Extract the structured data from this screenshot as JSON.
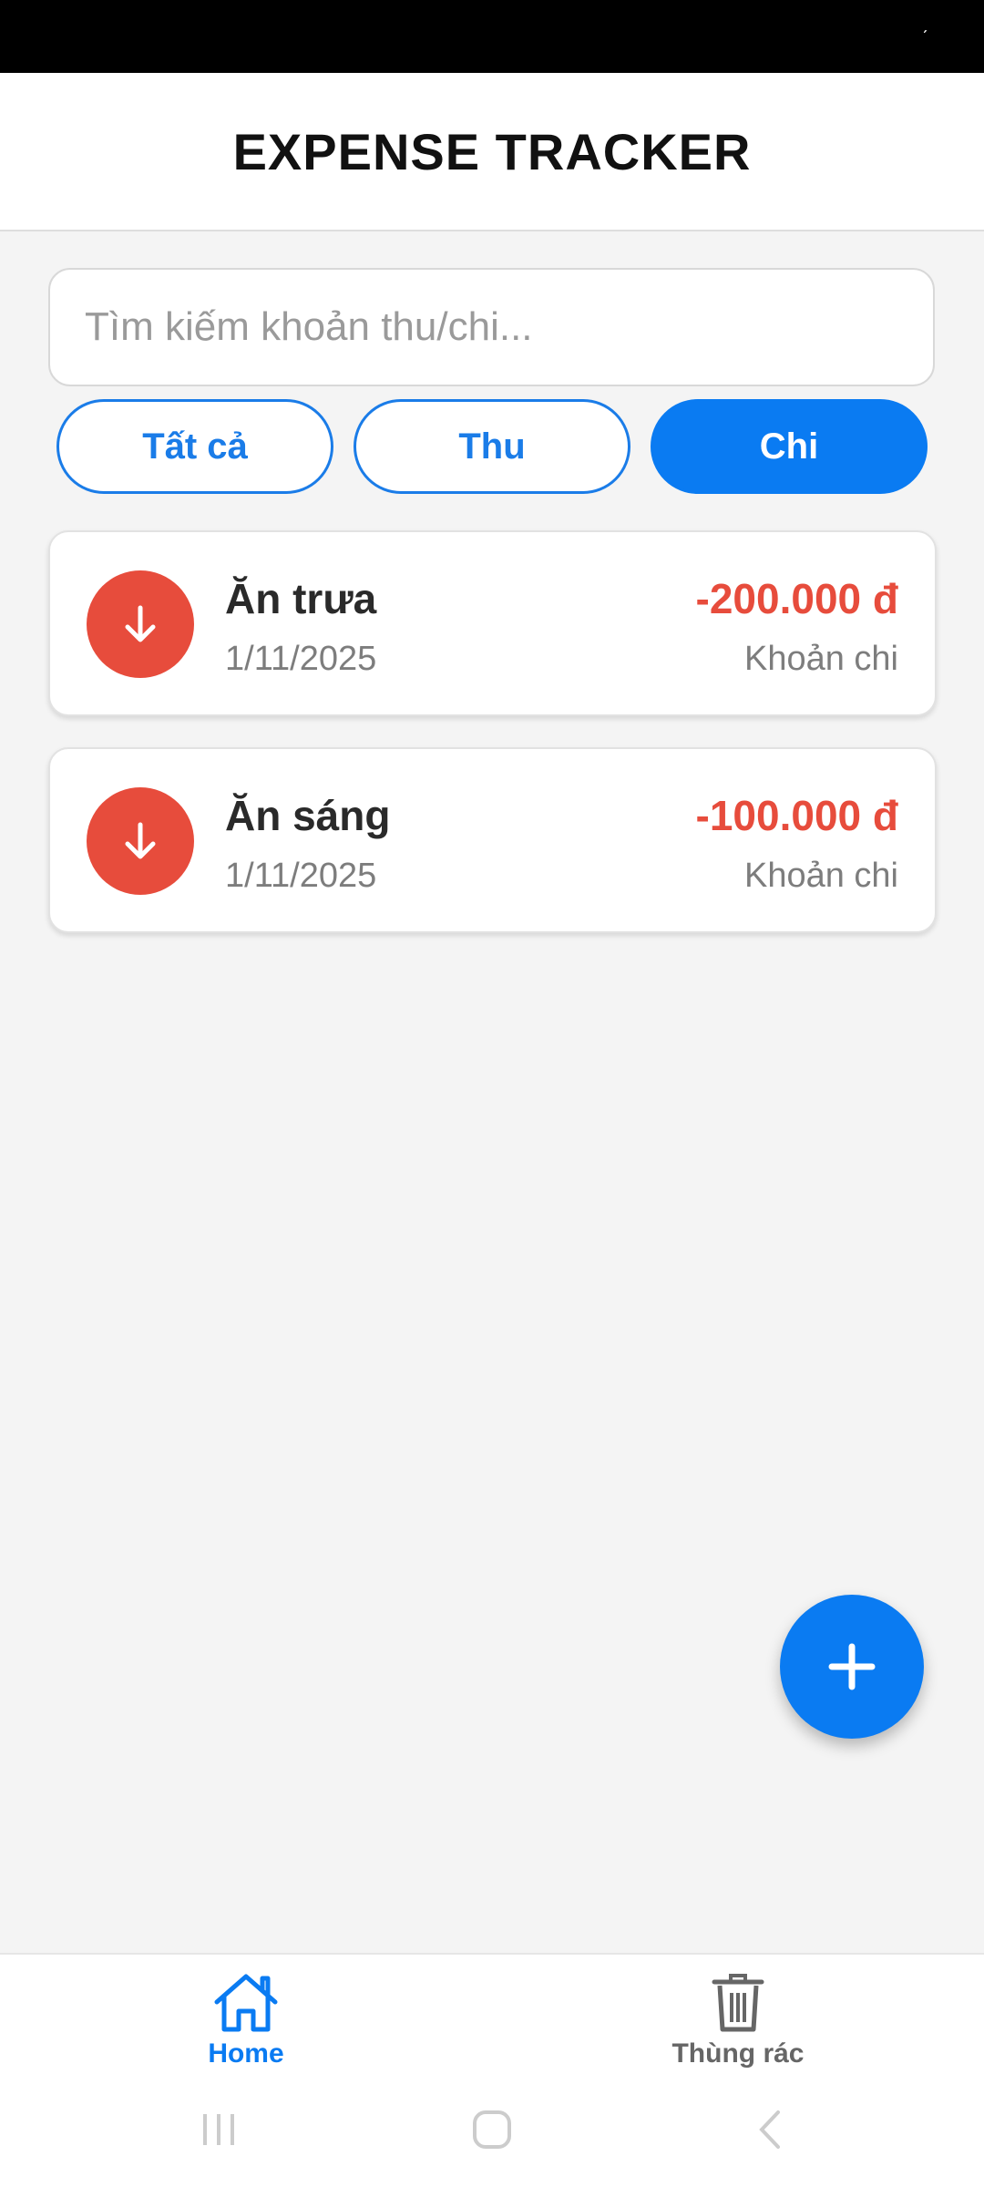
{
  "header": {
    "title": "EXPENSE TRACKER"
  },
  "search": {
    "placeholder": "Tìm kiếm khoản thu/chi..."
  },
  "filters": [
    {
      "label": "Tất cả",
      "active": false
    },
    {
      "label": "Thu",
      "active": false
    },
    {
      "label": "Chi",
      "active": true
    }
  ],
  "transactions": [
    {
      "title": "Ăn trưa",
      "date": "1/11/2025",
      "amount": "-200.000 đ",
      "type": "Khoản chi",
      "icon": "arrow-down-icon"
    },
    {
      "title": "Ăn sáng",
      "date": "1/11/2025",
      "amount": "-100.000 đ",
      "type": "Khoản chi",
      "icon": "arrow-down-icon"
    }
  ],
  "fab": {
    "icon": "plus-icon"
  },
  "bottom_nav": {
    "items": [
      {
        "label": "Home",
        "icon": "home-icon",
        "active": true
      },
      {
        "label": "Thùng rác",
        "icon": "trash-icon",
        "active": false
      }
    ]
  },
  "colors": {
    "accent": "#0a7bf2",
    "expense": "#e74c3c",
    "background": "#f4f4f4"
  }
}
